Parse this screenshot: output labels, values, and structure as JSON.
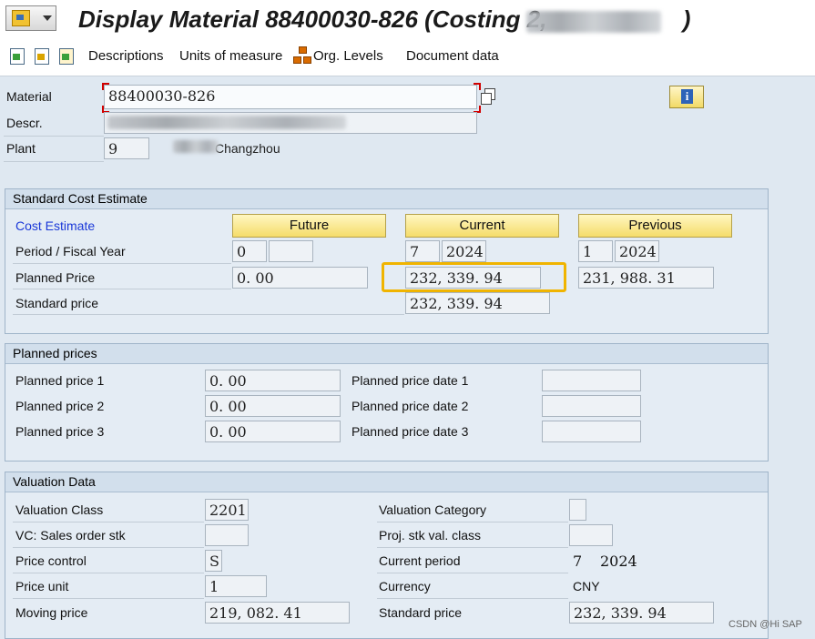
{
  "title": "Display Material 88400030-826 (Costing 2, ",
  "title_suffix": ")",
  "toolbar": {
    "descriptions": "Descriptions",
    "units_of_measure": "Units of measure",
    "org_levels": "Org. Levels",
    "document_data": "Document data"
  },
  "header": {
    "material_label": "Material",
    "material_value": "88400030-826",
    "descr_label": "Descr.",
    "plant_label": "Plant",
    "plant_value": "9",
    "plant_name": "Changzhou"
  },
  "standard_cost_estimate": {
    "title": "Standard Cost Estimate",
    "cost_estimate_link": "Cost Estimate",
    "future_label": "Future",
    "current_label": "Current",
    "previous_label": "Previous",
    "period_label": "Period / Fiscal Year",
    "planned_price_label": "Planned Price",
    "standard_price_label": "Standard price",
    "future": {
      "period": "0",
      "year": "",
      "planned_price": "0. 00"
    },
    "current": {
      "period": "7",
      "year": "2024",
      "planned_price": "232, 339. 94",
      "standard_price": "232, 339. 94"
    },
    "previous": {
      "period": "1",
      "year": "2024",
      "planned_price": "231, 988. 31"
    }
  },
  "planned_prices": {
    "title": "Planned prices",
    "rows": [
      {
        "label": "Planned price 1",
        "value": "0. 00",
        "date_label": "Planned price date 1",
        "date": ""
      },
      {
        "label": "Planned price 2",
        "value": "0. 00",
        "date_label": "Planned price date 2",
        "date": ""
      },
      {
        "label": "Planned price 3",
        "value": "0. 00",
        "date_label": "Planned price date 3",
        "date": ""
      }
    ]
  },
  "valuation_data": {
    "title": "Valuation Data",
    "valuation_class_label": "Valuation Class",
    "valuation_class": "2201",
    "vc_sales_order_label": "VC: Sales order stk",
    "vc_sales_order": "",
    "price_control_label": "Price control",
    "price_control": "S",
    "price_unit_label": "Price unit",
    "price_unit": "1",
    "moving_price_label": "Moving price",
    "moving_price": "219, 082. 41",
    "valuation_category_label": "Valuation Category",
    "valuation_category": "",
    "proj_stk_label": "Proj. stk val. class",
    "proj_stk": "",
    "current_period_label": "Current period",
    "current_period_month": "7",
    "current_period_year": "2024",
    "currency_label": "Currency",
    "currency": "CNY",
    "standard_price_label": "Standard price",
    "standard_price": "232, 339. 94"
  },
  "watermark": "CSDN @Hi SAP",
  "colors": {
    "highlight": "#f0b400",
    "link": "#1a38d8",
    "button_yellow": "#f5dc6a"
  }
}
